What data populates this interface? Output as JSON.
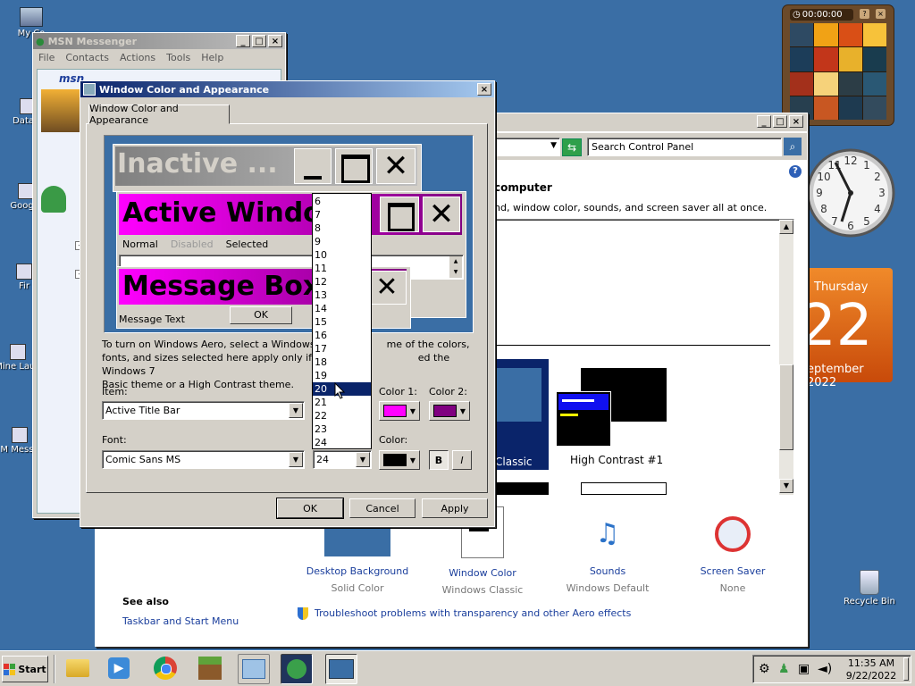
{
  "desktop_icons": [
    {
      "label": "My Co",
      "icon": "computer-icon"
    },
    {
      "label": "DataW",
      "icon": "shortcut-icon"
    },
    {
      "label": "Google",
      "icon": "shortcut-icon"
    },
    {
      "label": "Fir",
      "icon": "shortcut-icon"
    },
    {
      "label": "Mine Laun",
      "icon": "shortcut-icon"
    },
    {
      "label": "M Messe",
      "icon": "shortcut-icon"
    },
    {
      "label": "Recycle Bin",
      "icon": "recycle-bin-icon"
    }
  ],
  "puzzle": {
    "timer": "00:00:00"
  },
  "clock": {
    "icon": "clock-icon"
  },
  "calendar": {
    "day_name": "Thursday",
    "day": "22",
    "month": "eptember 2022"
  },
  "msn": {
    "title": "MSN Messenger",
    "menu": [
      "File",
      "Contacts",
      "Actions",
      "Tools",
      "Help"
    ],
    "logo": "msn"
  },
  "control_panel": {
    "search_placeholder": "Search Control Panel",
    "heading": "computer",
    "subtext": "nd, window color, sounds, and screen saver all at once.",
    "themes": [
      {
        "label": "Classic"
      },
      {
        "label": "High Contrast #1"
      }
    ],
    "items": [
      {
        "label": "Desktop Background",
        "sub": "Solid Color"
      },
      {
        "label": "Window Color",
        "sub": "Windows Classic"
      },
      {
        "label": "Sounds",
        "sub": "Windows Default"
      },
      {
        "label": "Screen Saver",
        "sub": "None"
      }
    ],
    "see_also": "See also",
    "taskbar_link": "Taskbar and Start Menu",
    "troubleshoot": "Troubleshoot problems with transparency and other Aero effects"
  },
  "dialog": {
    "title": "Window Color and Appearance",
    "tab": "Window Color and Appearance",
    "preview": {
      "inactive": "Inactive ...",
      "active": "Active Window",
      "menu_normal": "Normal",
      "menu_disabled": "Disabled",
      "menu_selected": "Selected",
      "msgbox": "Message Box",
      "msgtext": "Message Text",
      "ok": "OK"
    },
    "info": "To turn on Windows Aero, select a Windows 7 theme. The colors, fonts, and sizes selected here apply only if you have selected the Windows 7 Basic theme or a High Contrast theme.",
    "info_visible_1": "To turn on Windows Aero, select a Windows",
    "info_visible_1b": "me of the colors,",
    "info_visible_2": "fonts, and sizes selected here apply only if yo",
    "info_visible_2b": "ed the Windows 7",
    "info_visible_3": "Basic theme or a High Contrast theme.",
    "item_label": "Item:",
    "item_value": "Active Title Bar",
    "color1_label": "Color 1:",
    "color2_label": "Color 2:",
    "color1": "#ff00ff",
    "color2": "#800080",
    "font_label": "Font:",
    "font_value": "Comic Sans MS",
    "size_value": "24",
    "font_color_label": "Color:",
    "font_color": "#000000",
    "bold": "B",
    "italic": "I",
    "size_options": [
      "6",
      "7",
      "8",
      "9",
      "10",
      "11",
      "12",
      "13",
      "14",
      "15",
      "16",
      "17",
      "18",
      "19",
      "20",
      "21",
      "22",
      "23",
      "24"
    ],
    "size_highlighted": "20",
    "ok": "OK",
    "cancel": "Cancel",
    "apply": "Apply"
  },
  "taskbar": {
    "start": "Start",
    "time": "11:35 AM",
    "date": "9/22/2022"
  }
}
